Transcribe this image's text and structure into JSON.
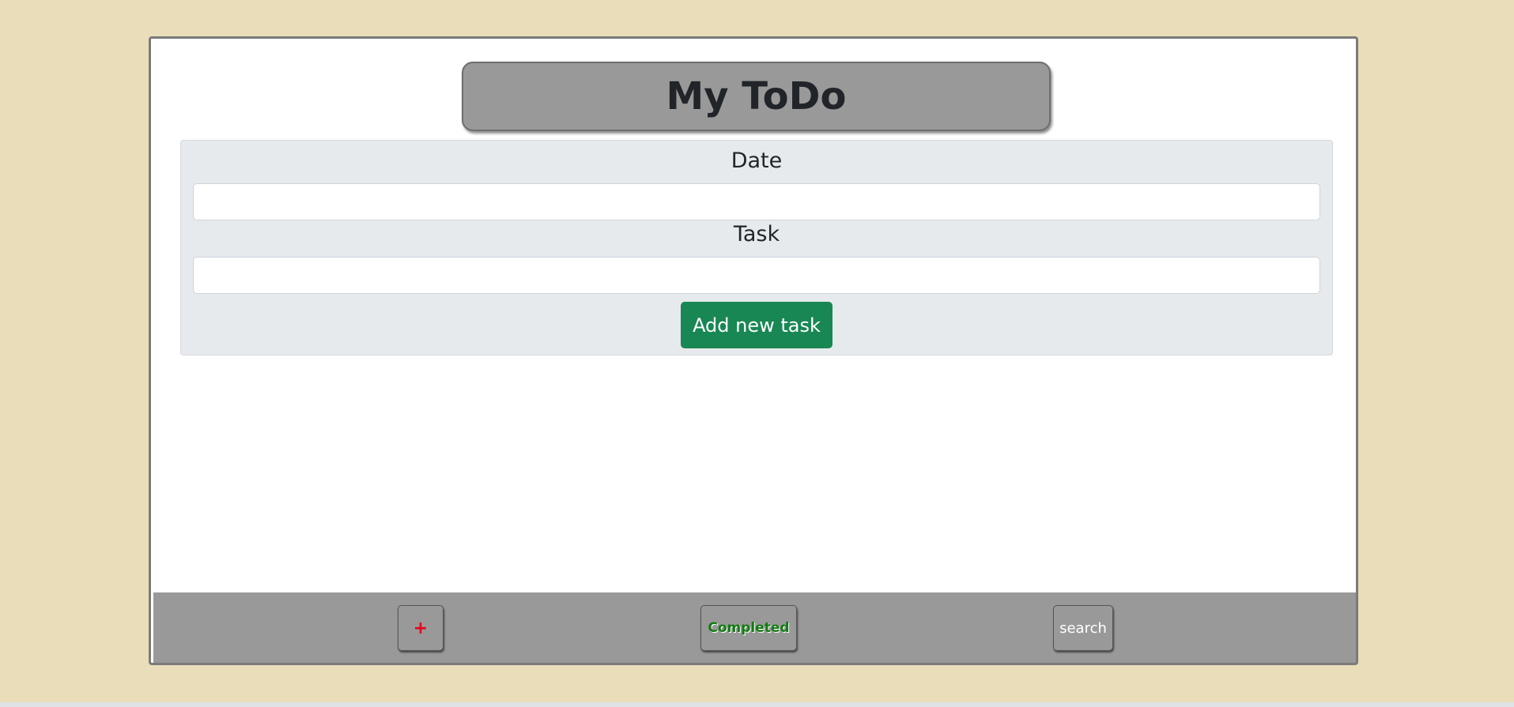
{
  "app": {
    "title": "My ToDo"
  },
  "form": {
    "date_label": "Date",
    "date_value": "",
    "date_placeholder": "",
    "task_label": "Task",
    "task_value": "",
    "task_placeholder": "",
    "add_button_label": "Add new task"
  },
  "footer": {
    "add_toggle_label": "+",
    "completed_label": "Completed",
    "search_label": "search"
  },
  "colors": {
    "page_background": "#e9ddba",
    "title_background": "#999999",
    "form_background": "#e7eaed",
    "add_button": "#198754",
    "footer_background": "#999999",
    "plus_glyph": "#e8001c",
    "completed_text": "#157a15"
  }
}
